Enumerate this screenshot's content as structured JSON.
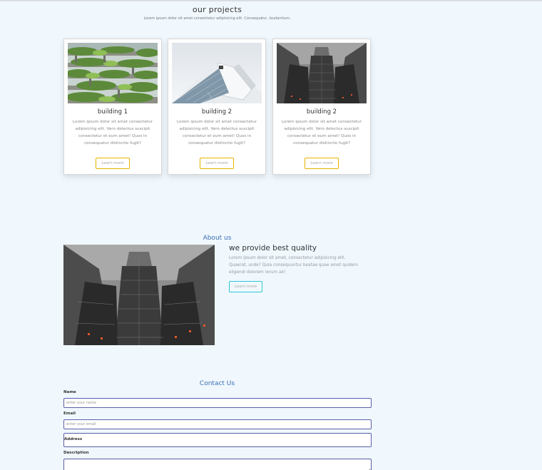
{
  "projects": {
    "title": "our projects",
    "subtitle": "Lorem ipsum dolor sit amet consectetur adipisicing elit. Consequatur, laudantium.",
    "cards": [
      {
        "image": "green-terraced-building-image",
        "title": "building 1",
        "text": "Lorem ipsum dolor sit amet consectetur adipisicing elit. Vero delectus suscipit consectetur et eum amet! Quos in consequatur distinctio fugit?",
        "button": "Learn more"
      },
      {
        "image": "modern-white-building-image",
        "title": "building 2",
        "text": "Lorem ipsum dolor sit amet consectetur adipisicing elit. Vero delectus suscipit consectetur et eum amet! Quos in consequatur distinctio fugit?",
        "button": "Learn more"
      },
      {
        "image": "skyscrapers-upward-view-image",
        "title": "building 2",
        "text": "Lorem ipsum dolor sit amet consectetur adipisicing elit. Vero delectus suscipit consectetur et eum amet! Quos in consequatur distinctio fugit?",
        "button": "Learn more"
      }
    ]
  },
  "about": {
    "heading": "About us",
    "image": "skyscrapers-upward-view-image",
    "title": "we provide best quality",
    "text": "Lorem ipsum dolor sit amet, consectetur adipisicing elit. Quaerat, unde? Quia consequuntur beatae quae amet quidem eligendi dolorem rerum ab!",
    "button": "Learn more"
  },
  "contact": {
    "heading": "Contact Us",
    "name_label": "Name",
    "name_placeholder": "enter your name",
    "email_label": "Email",
    "email_placeholder": "enter your email",
    "address_label": "Address",
    "description_label": "Description"
  },
  "colors": {
    "background": "#f0f8fe",
    "card_button_border": "#e6b400",
    "about_button_border": "#2ec6d6",
    "heading_blue": "#3b6fb5",
    "field_border": "#5a5fa8"
  }
}
